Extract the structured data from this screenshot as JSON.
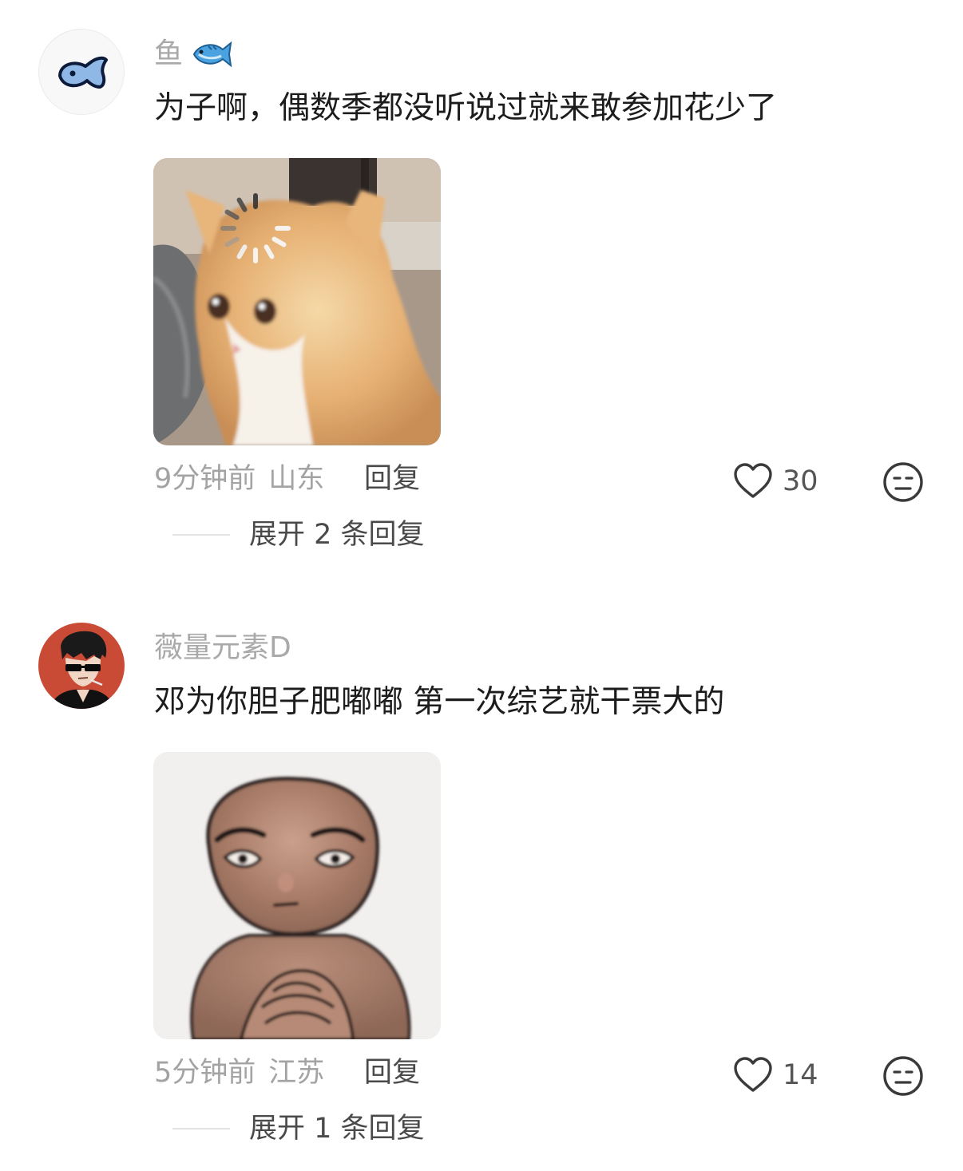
{
  "comments": [
    {
      "username": "鱼",
      "text": "为子啊，偶数季都没听说过就来敢参加花少了",
      "time": "9分钟前",
      "location": "山东",
      "reply_label": "回复",
      "likes": "30",
      "expand_label": "展开 2 条回复",
      "sticker": "loading-cat-sticker"
    },
    {
      "username": "薇量元素D",
      "text": "邓为你胆子肥嘟嘟 第一次综艺就干票大的",
      "time": "5分钟前",
      "location": "江苏",
      "reply_label": "回复",
      "likes": "14",
      "expand_label": "展开 1 条回复",
      "sticker": "squinting-doll-sticker"
    }
  ],
  "icons": {
    "like": "heart-outline-icon",
    "dislike": "meh-face-icon",
    "username_badge": "fish-emoji-icon"
  },
  "colors": {
    "username": "#a9a9a9",
    "text": "#1c1c1c",
    "meta": "#a3a3a3",
    "action": "#4a4a4a"
  }
}
